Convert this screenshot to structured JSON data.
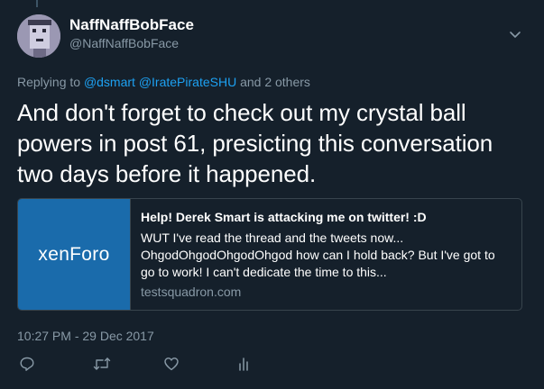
{
  "user": {
    "display_name": "NaffNaffBobFace",
    "handle": "@NaffNaffBobFace"
  },
  "reply": {
    "prefix": "Replying to",
    "mention_1": "@dsmart",
    "mention_2": "@IratePirateSHU",
    "suffix": "and 2 others"
  },
  "tweet": {
    "text": "And don't forget to check out my crystal ball powers in post 61, presicting this conversation two days before it happened."
  },
  "card": {
    "logo_text": "xenForo",
    "title": "Help! Derek Smart is attacking me on twitter! :D",
    "description": "WUT I've read the thread and the tweets now... OhgodOhgodOhgodOhgod how can I hold back? But I've got to go to work! I can't dedicate the time to this...",
    "domain": "testsquadron.com"
  },
  "timestamp": "10:27 PM - 29 Dec 2017",
  "icons": {
    "caret": "chevron-down-icon",
    "reply": "reply-icon",
    "retweet": "retweet-icon",
    "like": "heart-icon",
    "analytics": "analytics-icon"
  },
  "colors": {
    "background": "#15202b",
    "accent": "#1da1f2",
    "secondary_text": "#8899a6",
    "card_image_bg": "#1a6bab"
  }
}
